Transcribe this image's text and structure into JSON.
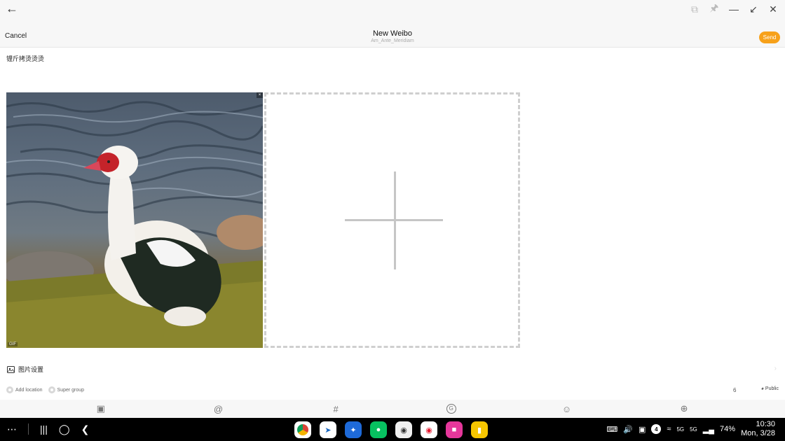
{
  "window": {
    "back_icon": "arrow-left-icon",
    "controls": [
      "multiwindow-icon",
      "pin-icon",
      "minimize-icon",
      "shrink-icon",
      "close-icon"
    ]
  },
  "header": {
    "cancel_label": "Cancel",
    "title": "New Weibo",
    "subtitle": "Am_Ante_Meridiam",
    "send_label": "Send"
  },
  "compose": {
    "text": "锂斤拷烫烫烫"
  },
  "images": {
    "photo_close_label": "×",
    "photo_tag": "GIF"
  },
  "settings": {
    "image_settings_label": "图片设置"
  },
  "meta": {
    "add_location": "Add location",
    "super_group": "Super group",
    "char_count": "6",
    "visibility": "Public"
  },
  "toolbar": {
    "icons": [
      "image-icon",
      "at-icon",
      "hashtag-icon",
      "gif-icon",
      "emoji-icon",
      "plus-circle-icon"
    ]
  },
  "taskbar": {
    "time": "10:30",
    "date": "Mon, 3/28",
    "battery": "74%",
    "notification_count": "4",
    "network1": "5G",
    "network2": "5G"
  }
}
